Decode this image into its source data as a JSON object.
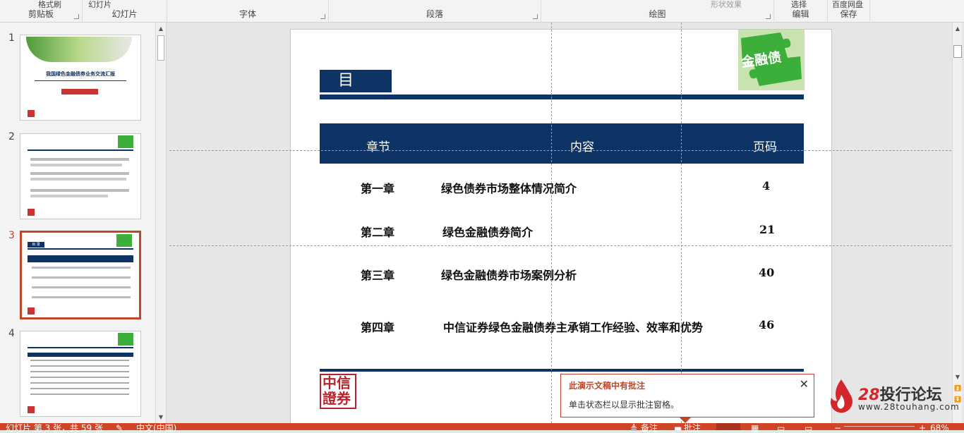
{
  "ribbon": {
    "groups": [
      {
        "label": "剪贴板",
        "top": "格式刷"
      },
      {
        "label": "幻灯片",
        "top": "幻灯片"
      },
      {
        "label": "字体",
        "top": ""
      },
      {
        "label": "段落",
        "top": ""
      },
      {
        "label": "绘图",
        "top": "形状效果"
      },
      {
        "label": "编辑",
        "top": "选择"
      },
      {
        "label": "保存",
        "top": "百度网盘"
      }
    ]
  },
  "thumbnails": {
    "items": [
      {
        "num": "1",
        "title": "我国绿色金融债券业务交流汇报"
      },
      {
        "num": "2"
      },
      {
        "num": "3",
        "title": "目 录"
      },
      {
        "num": "4"
      }
    ]
  },
  "slide": {
    "title": "目 录",
    "badge_text": "金融债",
    "table": {
      "headers": {
        "chapter": "章节",
        "content": "内容",
        "page": "页码"
      },
      "rows": [
        {
          "chapter": "第一章",
          "content": "绿色债券市场整体情况简介",
          "page": "4"
        },
        {
          "chapter": "第二章",
          "content": "绿色金融债券简介",
          "page": "21"
        },
        {
          "chapter": "第三章",
          "content": "绿色金融债券市场案例分析",
          "page": "40"
        },
        {
          "chapter": "第四章",
          "content": "中信证券绿色金融债券主承销工作经验、效率和优势",
          "page": "46"
        }
      ]
    },
    "logo_text": "中信證券"
  },
  "comment_popup": {
    "title": "此演示文稿中有批注",
    "body": "单击状态栏以显示批注窗格。"
  },
  "status_bar": {
    "slide_info": "幻灯片 第 3 张，共 59 张",
    "language": "中文(中国)",
    "notes_label": "备注",
    "comments_label": "批注",
    "zoom": "68%"
  },
  "watermark": {
    "brand_num": "28",
    "brand_text": "投行论坛",
    "url": "www.28touhang.com"
  },
  "colors": {
    "accent": "#c0462a",
    "slide_navy": "#0e3466",
    "badge_green": "#3cae3a",
    "statusbar": "#d04525"
  }
}
